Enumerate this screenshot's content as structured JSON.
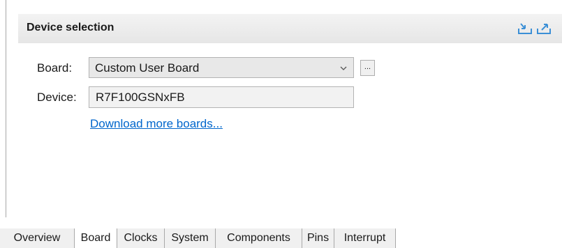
{
  "section": {
    "title": "Device selection"
  },
  "header_icons": [
    "import-icon",
    "export-icon"
  ],
  "form": {
    "board_label": "Board:",
    "board_value": "Custom User Board",
    "browse_label": "...",
    "device_label": "Device:",
    "device_value": "R7F100GSNxFB",
    "download_link": "Download more boards..."
  },
  "tabs": [
    {
      "label": "Overview",
      "active": false
    },
    {
      "label": "Board",
      "active": true
    },
    {
      "label": "Clocks",
      "active": false
    },
    {
      "label": "System",
      "active": false
    },
    {
      "label": "Components",
      "active": false
    },
    {
      "label": "Pins",
      "active": false
    },
    {
      "label": "Interrupt",
      "active": false
    }
  ],
  "colors": {
    "accent": "#0066cc",
    "icon": "#3b8fd6",
    "header_bg": "#e8e8e8"
  }
}
